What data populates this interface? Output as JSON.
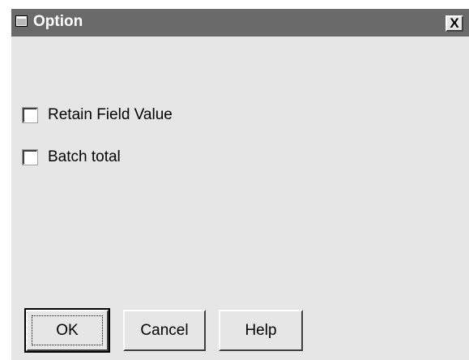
{
  "window": {
    "title": "Option",
    "close_label": "X"
  },
  "options": [
    {
      "label": "Retain Field Value",
      "checked": false
    },
    {
      "label": "Batch total",
      "checked": false
    }
  ],
  "buttons": {
    "ok": "OK",
    "cancel": "Cancel",
    "help": "Help"
  },
  "colors": {
    "titlebar": "#6a6a6a",
    "background": "#e6e6e6"
  },
  "icons": {
    "system_menu": "window-menu-icon",
    "close": "close-icon"
  }
}
